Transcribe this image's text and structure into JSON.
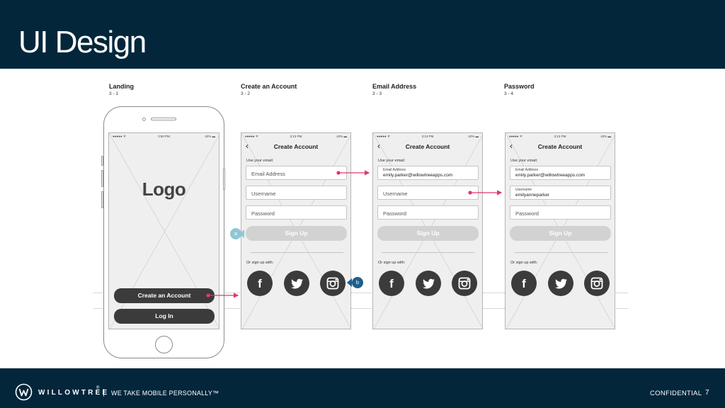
{
  "slide": {
    "title": "UI Design",
    "footer": {
      "brand": "WILLOWTREE",
      "registered": "®",
      "separator": "|",
      "tagline": "WE TAKE MOBILE PERSONALLY™",
      "confidential": "CONFIDENTIAL",
      "page_number": "7"
    }
  },
  "colors": {
    "bar_navy": "#03263b",
    "arrow_pink": "#e2376b",
    "callout_a": "#8fc7d3",
    "callout_b": "#1f5f8a",
    "dark_button": "#3b3b3b",
    "disabled_button": "#d2d2d2"
  },
  "sections": [
    {
      "title": "Landing",
      "number": "3 - 1"
    },
    {
      "title": "Create an Account",
      "number": "3 - 2"
    },
    {
      "title": "Email Address",
      "number": "3 - 3"
    },
    {
      "title": "Password",
      "number": "3 - 4"
    }
  ],
  "status_bar": {
    "signal": "●●●●● ᯤ",
    "landing_time": "3:50 PM",
    "time": "3:13 PM",
    "battery": "42% ▬"
  },
  "landing": {
    "logo": "Logo",
    "create_button": "Create an Account",
    "login_button": "Log In"
  },
  "form": {
    "back": "‹",
    "header": "Create Account",
    "use_email": "Use your email:",
    "email_placeholder": "Email Address",
    "username_placeholder": "Username",
    "password_placeholder": "Password",
    "email_label": "Email Address",
    "email_value": "emily.parker@willowtreeapps.com",
    "username_label": "Username",
    "username_value": "emilyanneparker",
    "sign_up": "Sign Up",
    "or_sign_up_with": "Or sign up with:",
    "facebook": "f"
  },
  "callouts": {
    "a": "a",
    "b": "b"
  },
  "icons": [
    "willowtree-logo-icon",
    "back-chevron-icon",
    "facebook-icon",
    "twitter-icon",
    "instagram-icon"
  ]
}
